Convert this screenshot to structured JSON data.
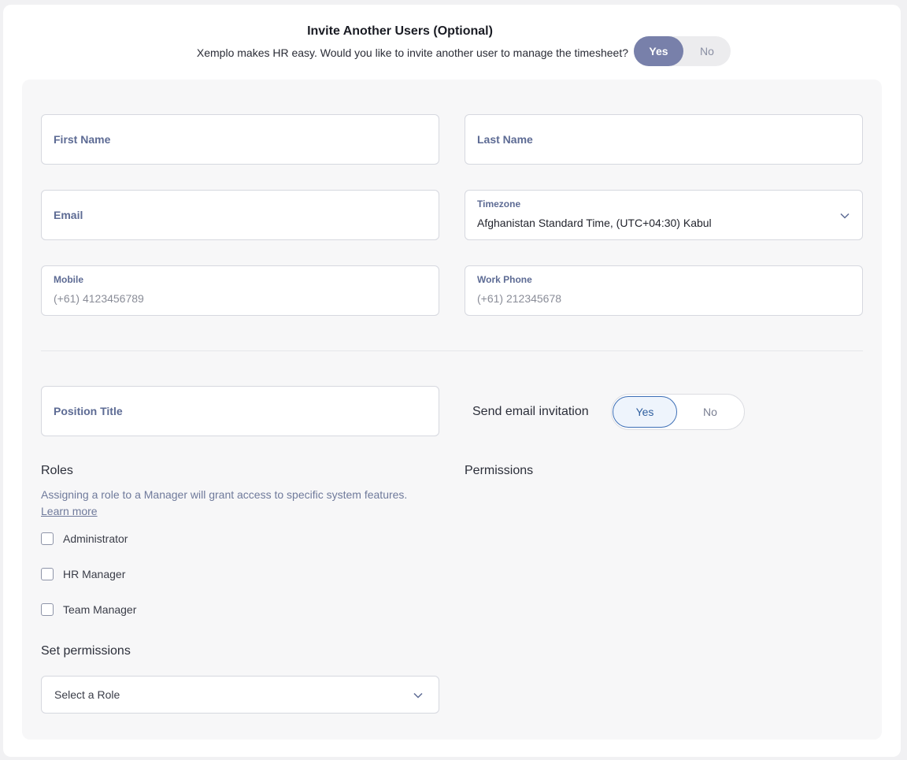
{
  "header": {
    "title": "Invite Another Users (Optional)",
    "question": "Xemplo makes HR easy. Would you like to invite another user to manage the timesheet?",
    "toggle_yes": "Yes",
    "toggle_no": "No",
    "selected": "Yes"
  },
  "form": {
    "first_name": {
      "label": "First Name"
    },
    "last_name": {
      "label": "Last Name"
    },
    "email": {
      "label": "Email"
    },
    "timezone": {
      "label": "Timezone",
      "value": "Afghanistan Standard Time, (UTC+04:30) Kabul"
    },
    "mobile": {
      "label": "Mobile",
      "placeholder": "(+61) 4123456789"
    },
    "work_phone": {
      "label": "Work Phone",
      "placeholder": "(+61) 212345678"
    },
    "position_title": {
      "label": "Position Title"
    },
    "send_email": {
      "label": "Send email invitation",
      "yes": "Yes",
      "no": "No",
      "selected": "Yes"
    }
  },
  "roles": {
    "heading": "Roles",
    "description": "Assigning a role to a Manager will grant access to specific system features.",
    "learn_more": "Learn more",
    "items": [
      {
        "label": "Administrator",
        "checked": false
      },
      {
        "label": "HR Manager",
        "checked": false
      },
      {
        "label": "Team Manager",
        "checked": false
      }
    ]
  },
  "permissions": {
    "heading": "Permissions",
    "set_heading": "Set permissions",
    "select_placeholder": "Select a Role"
  },
  "colors": {
    "toggle_active": "#7880aa",
    "label_blue": "#5d6b94",
    "send_yes_border": "#3d6fb6"
  }
}
